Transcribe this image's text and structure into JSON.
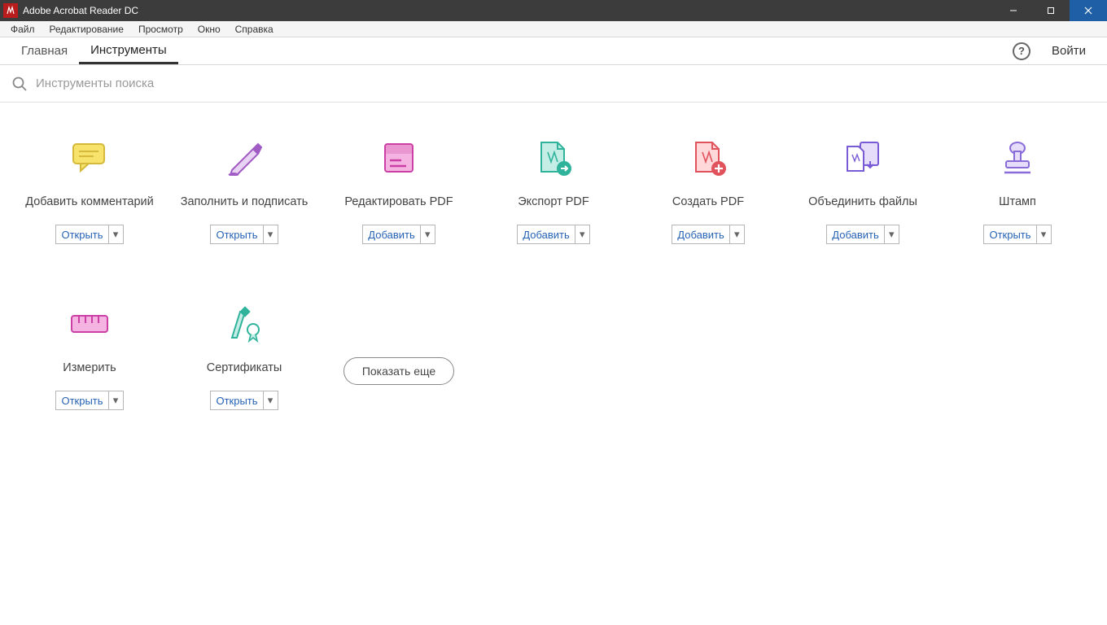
{
  "window": {
    "title": "Adobe Acrobat Reader DC"
  },
  "menubar": {
    "items": [
      "Файл",
      "Редактирование",
      "Просмотр",
      "Окно",
      "Справка"
    ]
  },
  "tabs": {
    "home": "Главная",
    "tools": "Инструменты",
    "signin": "Войти"
  },
  "search": {
    "placeholder": "Инструменты поиска"
  },
  "actions": {
    "open": "Открыть",
    "add": "Добавить"
  },
  "tools": [
    {
      "label": "Добавить комментарий",
      "action": "open"
    },
    {
      "label": "Заполнить и подписать",
      "action": "open"
    },
    {
      "label": "Редактировать PDF",
      "action": "add"
    },
    {
      "label": "Экспорт PDF",
      "action": "add"
    },
    {
      "label": "Создать PDF",
      "action": "add"
    },
    {
      "label": "Объединить файлы",
      "action": "add"
    },
    {
      "label": "Штамп",
      "action": "open"
    },
    {
      "label": "Измерить",
      "action": "open"
    },
    {
      "label": "Сертификаты",
      "action": "open"
    }
  ],
  "show_more": "Показать еще"
}
